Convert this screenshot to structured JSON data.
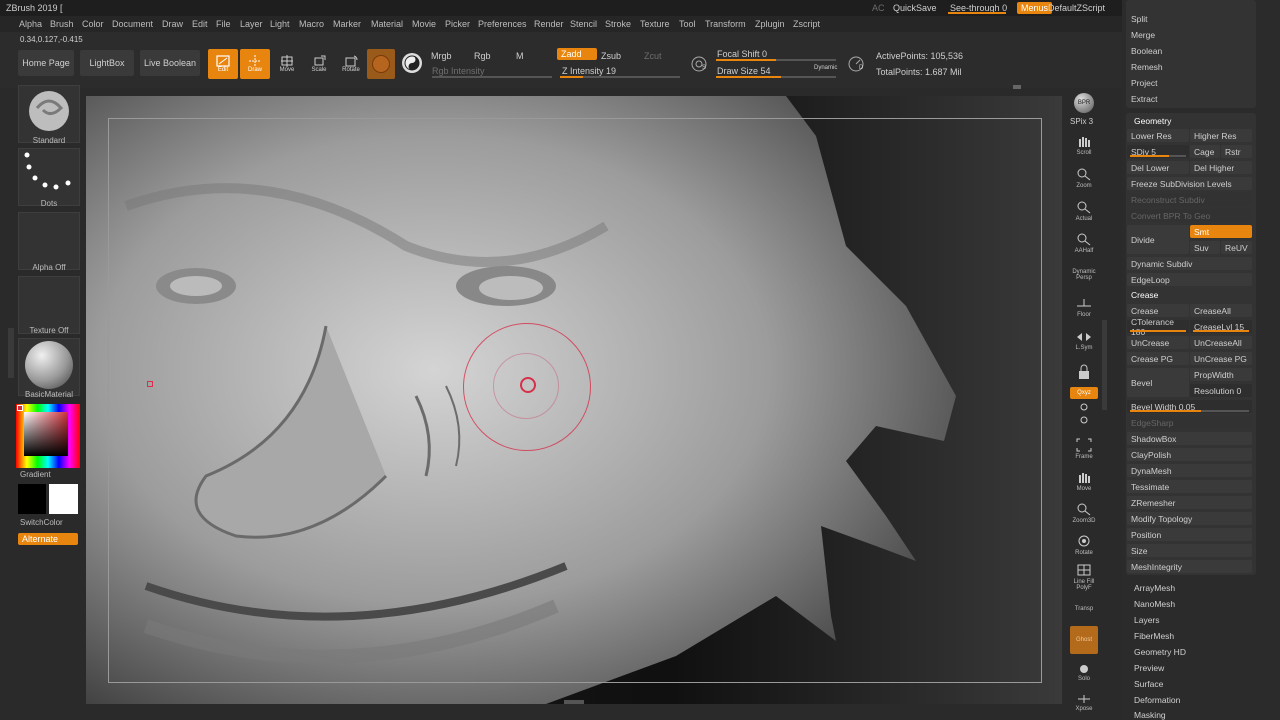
{
  "app": {
    "title": "ZBrush 2019 ["
  },
  "menus": [
    "Alpha",
    "Brush",
    "Color",
    "Document",
    "Draw",
    "Edit",
    "File",
    "Layer",
    "Light",
    "Macro",
    "Marker",
    "Material",
    "Movie",
    "Picker",
    "Preferences",
    "Render",
    "Stencil",
    "Stroke",
    "Texture",
    "Tool",
    "Transform",
    "Zplugin",
    "Zscript"
  ],
  "topright": {
    "ac": "AC",
    "quicksave": "QuickSave",
    "seethrough": "See-through",
    "seethrough_val": "0",
    "menus": "Menus",
    "defaultzscript": "DefaultZScript"
  },
  "coords": "0.34,0.127,-0.415",
  "shelf": {
    "home": "Home Page",
    "lightbox": "LightBox",
    "liveboolean": "Live Boolean",
    "edit": "Edit",
    "draw": "Draw",
    "move": "Move",
    "scale": "Scale",
    "rotate": "Rotate",
    "mrgb": "Mrgb",
    "rgb": "Rgb",
    "m": "M",
    "rgb_intensity": "Rgb Intensity",
    "zadd": "Zadd",
    "zsub": "Zsub",
    "zcut": "Zcut",
    "z_intensity": "Z Intensity 19",
    "focal_shift": "Focal Shift 0",
    "draw_size": "Draw Size 54",
    "dynamic": "Dynamic",
    "active_points": "ActivePoints: 105,536",
    "total_points": "TotalPoints: 1.687 Mil",
    "focal_letter": "S",
    "draw_letter": "D"
  },
  "levels": {
    "z_intensity": 0.19,
    "draw_size": 0.54,
    "focal_shift": 0.5
  },
  "left": {
    "standard": "Standard",
    "dots": "Dots",
    "alphaoff": "Alpha Off",
    "textureoff": "Texture Off",
    "basicmaterial": "BasicMaterial",
    "gradient": "Gradient",
    "switchcolor": "SwitchColor",
    "alternate": "Alternate"
  },
  "rightshelf": [
    "BPR",
    "SPix 3",
    "Scroll",
    "Zoom",
    "Actual",
    "AAHalf",
    "Dynamic Persp",
    "Floor",
    "L.Sym",
    "Qxyz",
    "Frame",
    "Move",
    "Zoom3D",
    "Rotate",
    "Line Fill PolyF",
    "Transp",
    "Ghost",
    "Solo",
    "Xpose"
  ],
  "palette": {
    "top_items": [
      "Split",
      "Merge",
      "Boolean",
      "Remesh",
      "Project",
      "Extract"
    ],
    "geometry": "Geometry",
    "lowerres": "Lower Res",
    "higherres": "Higher Res",
    "sdiv": "SDiv 5",
    "cage": "Cage",
    "rstr": "Rstr",
    "dellower": "Del Lower",
    "delhigher": "Del Higher",
    "freeze": "Freeze SubDivision Levels",
    "reconstruct": "Reconstruct Subdiv",
    "convertbpr": "Convert BPR To Geo",
    "divide": "Divide",
    "smt": "Smt",
    "suv": "Suv",
    "reuv": "ReUV",
    "dynsubdiv": "Dynamic Subdiv",
    "edgeloop": "EdgeLoop",
    "crease_head": "Crease",
    "crease": "Crease",
    "creaseall": "CreaseAll",
    "ctolerance": "CTolerance 180",
    "creaselvl": "CreaseLvl 15",
    "uncrease": "UnCrease",
    "uncreaseall": "UnCreaseAll",
    "creasepg": "Crease PG",
    "uncreasepg": "UnCrease PG",
    "bevel": "Bevel",
    "propwidth": "PropWidth",
    "resolution": "Resolution 0",
    "bevelwidth": "Bevel Width 0.05",
    "edgesharp": "EdgeSharp",
    "lower_items": [
      "ShadowBox",
      "ClayPolish",
      "DynaMesh",
      "Tessimate",
      "ZRemesher",
      "Modify Topology",
      "Position",
      "Size",
      "MeshIntegrity"
    ],
    "sub_items": [
      "ArrayMesh",
      "NanoMesh",
      "Layers",
      "FiberMesh",
      "Geometry HD",
      "Preview",
      "Surface",
      "Deformation",
      "Masking"
    ]
  },
  "colors": {
    "accent": "#e8850f",
    "bg": "#2a2a2a",
    "cursor": "#d6304a"
  }
}
